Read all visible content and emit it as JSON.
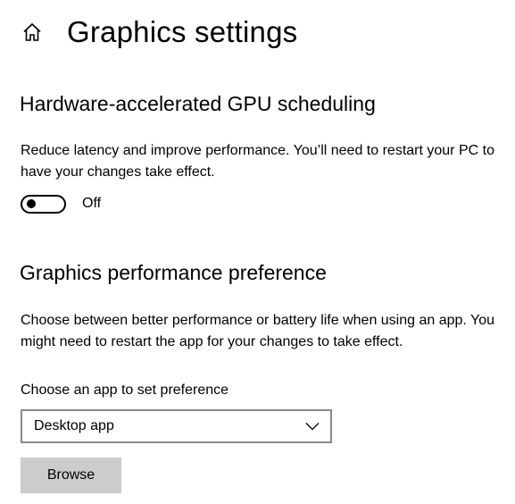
{
  "header": {
    "title": "Graphics settings",
    "home_icon": "home-icon"
  },
  "gpu_scheduling": {
    "title": "Hardware-accelerated GPU scheduling",
    "description": "Reduce latency and improve performance. You’ll need to restart your PC to have your changes take effect.",
    "toggle_state": "Off",
    "toggle_on": false
  },
  "performance_preference": {
    "title": "Graphics performance preference",
    "description": "Choose between better performance or battery life when using an app. You might need to restart the app for your changes to take effect.",
    "choose_label": "Choose an app to set preference",
    "dropdown_value": "Desktop app",
    "dropdown_icon": "chevron-down-icon",
    "browse_label": "Browse"
  },
  "colors": {
    "background": "#ffffff",
    "text": "#000000",
    "button_bg": "#cccccc",
    "dropdown_border": "#8a8a8a"
  }
}
